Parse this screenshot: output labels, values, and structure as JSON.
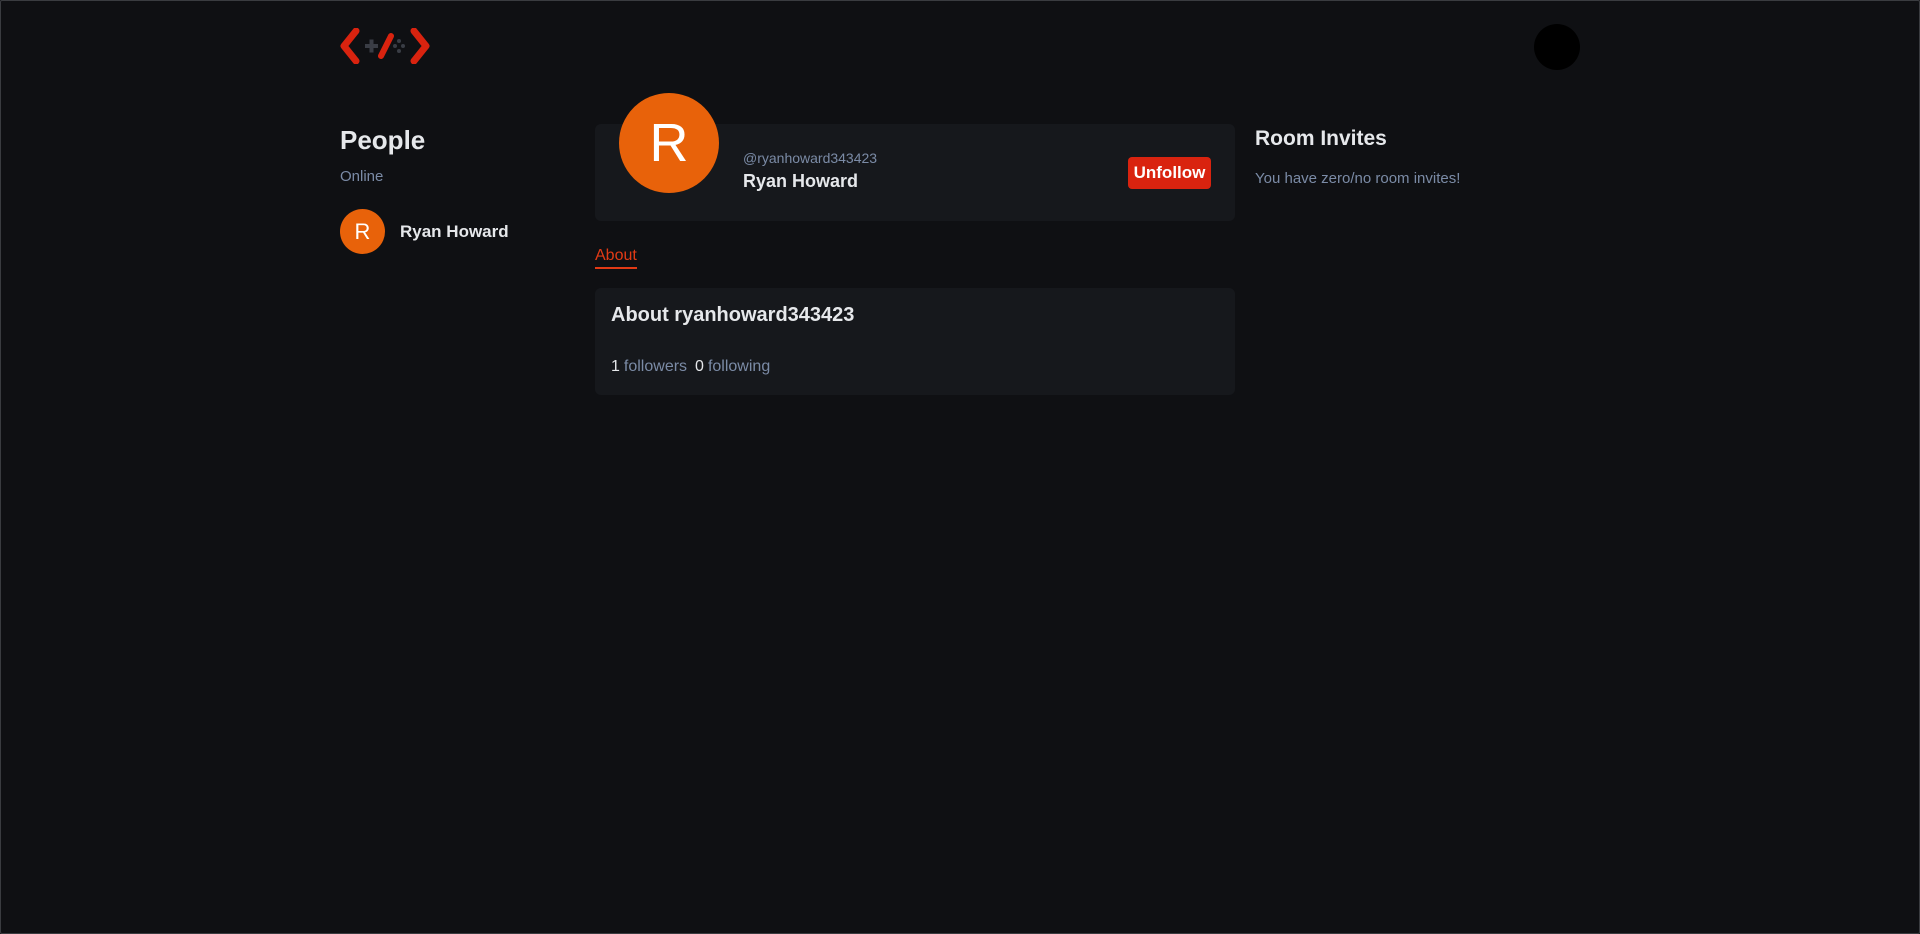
{
  "header": {
    "logo_icon": "code-gamepad-logo",
    "brand_color": "#d9230f"
  },
  "people": {
    "title": "People",
    "status_label": "Online",
    "items": [
      {
        "initial": "R",
        "name": "Ryan Howard"
      }
    ]
  },
  "profile": {
    "initial": "R",
    "handle": "@ryanhoward343423",
    "name": "Ryan Howard",
    "unfollow_label": "Unfollow",
    "avatar_color": "#e8620a"
  },
  "tabs": {
    "about_label": "About"
  },
  "about": {
    "title": "About ryanhoward343423",
    "followers_count": "1",
    "followers_label": "followers",
    "following_count": "0",
    "following_label": "following"
  },
  "room_invites": {
    "title": "Room Invites",
    "empty_text": "You have zero/no room invites!"
  }
}
